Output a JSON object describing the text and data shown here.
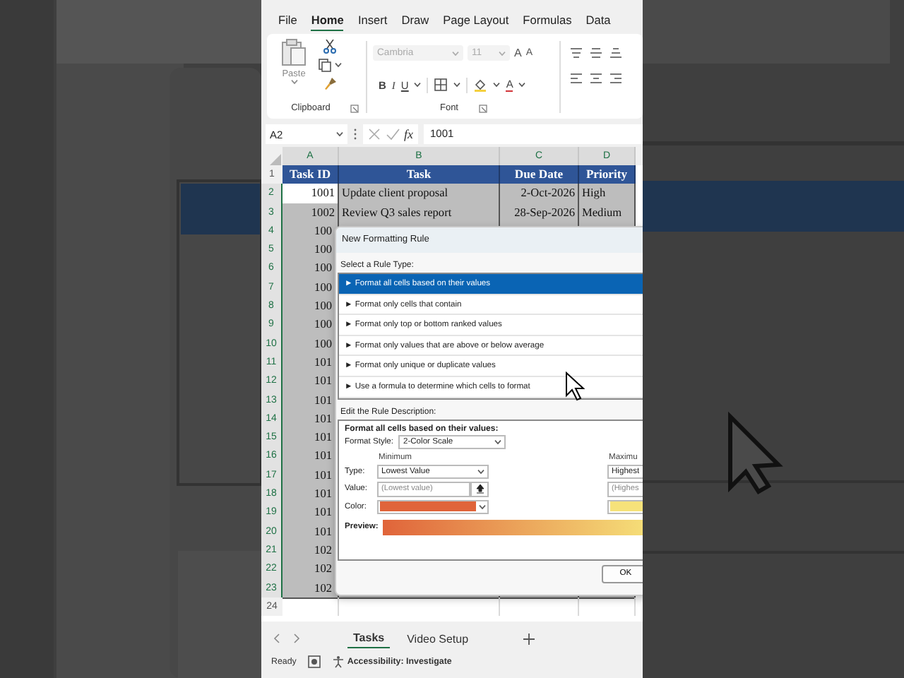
{
  "ribbon_tabs": [
    {
      "label": "File",
      "selected": false
    },
    {
      "label": "Home",
      "selected": true
    },
    {
      "label": "Insert",
      "selected": false
    },
    {
      "label": "Draw",
      "selected": false
    },
    {
      "label": "Page Layout",
      "selected": false
    },
    {
      "label": "Formulas",
      "selected": false
    },
    {
      "label": "Data",
      "selected": false
    }
  ],
  "clipboard": {
    "paste": "Paste",
    "label": "Clipboard"
  },
  "font": {
    "name": "Cambria",
    "size": "11",
    "disabled": true,
    "size_buttons": [
      {
        "label": "A",
        "kind": "grow"
      },
      {
        "label": "A",
        "kind": "shrink"
      }
    ],
    "style_buttons": [
      {
        "label": "B",
        "kind": "bold"
      },
      {
        "label": "I",
        "kind": "italic"
      },
      {
        "label": "U",
        "kind": "underline"
      }
    ],
    "font_color": "A",
    "label": "Font"
  },
  "formula_bar": {
    "name_box": "A2",
    "fx": "fx",
    "formula": "1001"
  },
  "columns": [
    "A",
    "B",
    "C",
    "D"
  ],
  "rows": [
    {
      "number": "1",
      "kind": "header",
      "selected": false,
      "active": false,
      "cells": [
        "Task ID",
        "Task",
        "Due Date",
        "Priority"
      ]
    },
    {
      "number": "2",
      "kind": "data",
      "selected": true,
      "active": true,
      "cells": [
        "1001",
        "Update client proposal",
        "2-Oct-2026",
        "High"
      ]
    },
    {
      "number": "3",
      "kind": "data",
      "selected": true,
      "active": false,
      "cells": [
        "1002",
        "Review Q3 sales report",
        "28-Sep-2026",
        "Medium"
      ]
    },
    {
      "number": "4",
      "kind": "data",
      "selected": true,
      "active": false,
      "cells": [
        "100"
      ]
    },
    {
      "number": "5",
      "kind": "data",
      "selected": true,
      "active": false,
      "cells": [
        "100"
      ]
    },
    {
      "number": "6",
      "kind": "data",
      "selected": true,
      "active": false,
      "cells": [
        "100"
      ]
    },
    {
      "number": "7",
      "kind": "data",
      "selected": true,
      "active": false,
      "cells": [
        "100"
      ]
    },
    {
      "number": "8",
      "kind": "data",
      "selected": true,
      "active": false,
      "cells": [
        "100"
      ]
    },
    {
      "number": "9",
      "kind": "data",
      "selected": true,
      "active": false,
      "cells": [
        "100"
      ]
    },
    {
      "number": "10",
      "kind": "data",
      "selected": true,
      "active": false,
      "cells": [
        "100"
      ]
    },
    {
      "number": "11",
      "kind": "data",
      "selected": true,
      "active": false,
      "cells": [
        "101"
      ]
    },
    {
      "number": "12",
      "kind": "data",
      "selected": true,
      "active": false,
      "cells": [
        "101"
      ]
    },
    {
      "number": "13",
      "kind": "data",
      "selected": true,
      "active": false,
      "cells": [
        "101"
      ]
    },
    {
      "number": "14",
      "kind": "data",
      "selected": true,
      "active": false,
      "cells": [
        "101"
      ]
    },
    {
      "number": "15",
      "kind": "data",
      "selected": true,
      "active": false,
      "cells": [
        "101"
      ]
    },
    {
      "number": "16",
      "kind": "data",
      "selected": true,
      "active": false,
      "cells": [
        "101"
      ]
    },
    {
      "number": "17",
      "kind": "data",
      "selected": true,
      "active": false,
      "cells": [
        "101"
      ]
    },
    {
      "number": "18",
      "kind": "data",
      "selected": true,
      "active": false,
      "cells": [
        "101"
      ]
    },
    {
      "number": "19",
      "kind": "data",
      "selected": true,
      "active": false,
      "cells": [
        "101"
      ]
    },
    {
      "number": "20",
      "kind": "data",
      "selected": true,
      "active": false,
      "cells": [
        "101"
      ]
    },
    {
      "number": "21",
      "kind": "data",
      "selected": true,
      "active": false,
      "cells": [
        "102"
      ]
    },
    {
      "number": "22",
      "kind": "data",
      "selected": true,
      "active": false,
      "cells": [
        "102"
      ]
    },
    {
      "number": "23",
      "kind": "data",
      "selected": true,
      "active": false,
      "cells": [
        "102"
      ]
    },
    {
      "number": "24",
      "kind": "data",
      "selected": false,
      "active": false,
      "cells": []
    }
  ],
  "dialog": {
    "title": "New Formatting Rule",
    "select_label": "Select a Rule Type:",
    "rule_types": [
      {
        "label": "► Format all cells based on their values",
        "selected": true
      },
      {
        "label": "► Format only cells that contain",
        "selected": false
      },
      {
        "label": "► Format only top or bottom ranked values",
        "selected": false
      },
      {
        "label": "► Format only values that are above or below average",
        "selected": false
      },
      {
        "label": "► Format only unique or duplicate values",
        "selected": false
      },
      {
        "label": "► Use a formula to determine which cells to format",
        "selected": false
      }
    ],
    "edit_label": "Edit the Rule Description:",
    "description_heading": "Format all cells based on their values:",
    "format_style_label": "Format Style:",
    "format_style": "2-Color Scale",
    "type_label": "Type:",
    "value_label": "Value:",
    "color_label": "Color:",
    "minimum": {
      "heading": "Minimum",
      "type": "Lowest Value",
      "value_placeholder": "(Lowest value)",
      "color": "#e0643a"
    },
    "maximum": {
      "heading": "Maximu",
      "type": "Highest",
      "value_placeholder": "(Highes",
      "color": "#f6e27a"
    },
    "preview_label": "Preview:",
    "ok": "OK"
  },
  "sheet_tabs": [
    {
      "label": "Tasks",
      "selected": true
    },
    {
      "label": "Video Setup",
      "selected": false
    }
  ],
  "status_bar": {
    "mode": "Ready",
    "accessibility": "Accessibility: Investigate"
  }
}
